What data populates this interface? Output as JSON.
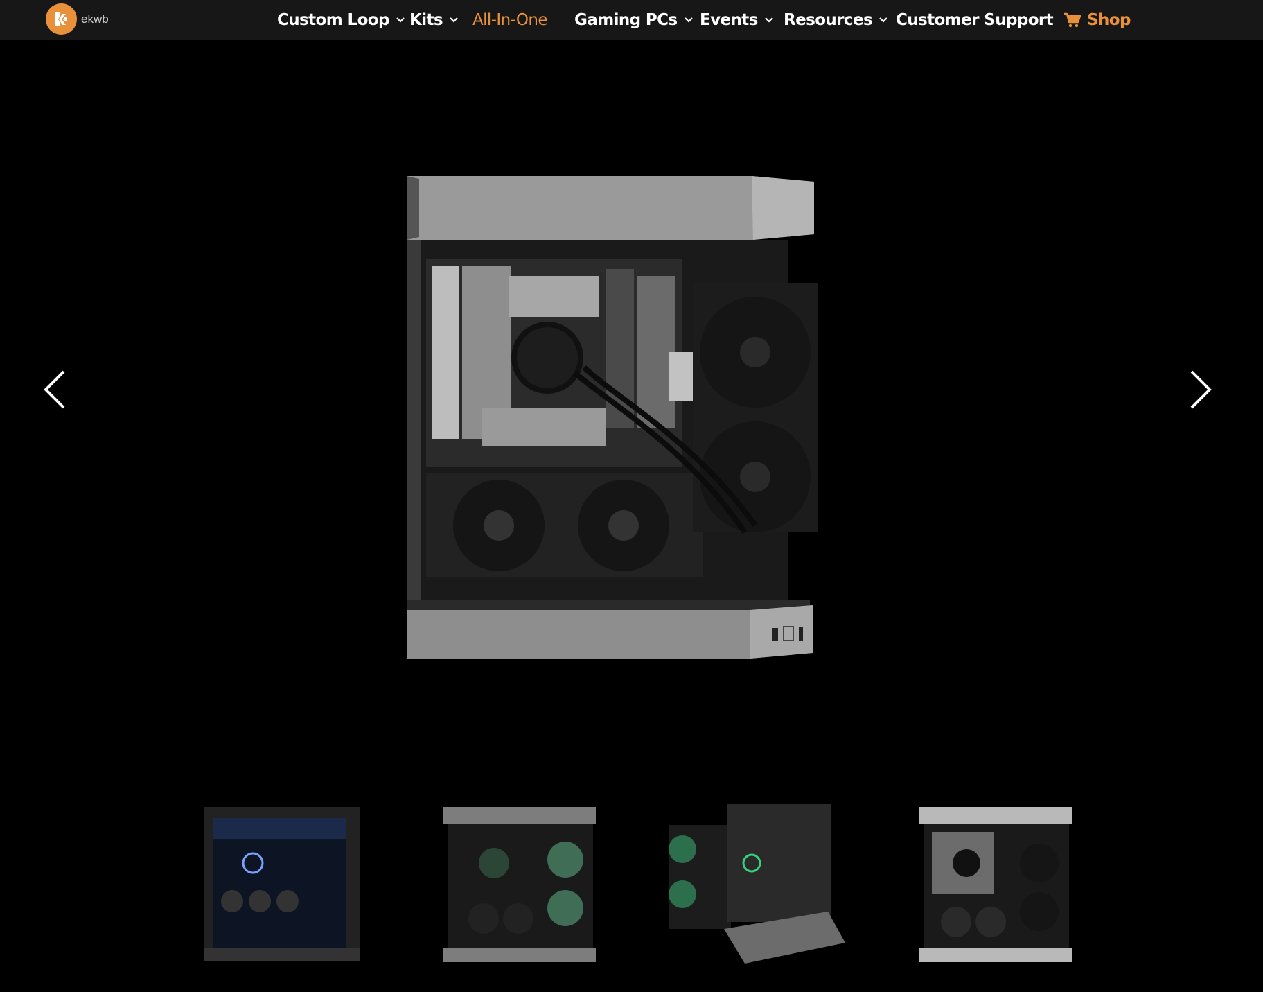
{
  "brand": {
    "name": "ekwb",
    "accent": "#e8913a"
  },
  "nav": {
    "items": [
      {
        "label": "Custom Loop",
        "dropdown": true
      },
      {
        "label": "Kits",
        "dropdown": true
      },
      {
        "label": "All-In-One",
        "dropdown": false,
        "active": true
      },
      {
        "label": "Gaming PCs",
        "dropdown": true
      },
      {
        "label": "Events",
        "dropdown": true
      },
      {
        "label": "Resources",
        "dropdown": true
      },
      {
        "label": "Customer Support",
        "dropdown": false
      }
    ],
    "shop_label": "Shop",
    "shop_icon": "cart-icon"
  },
  "gallery": {
    "prev_icon": "chevron-left-icon",
    "next_icon": "chevron-right-icon",
    "thumbnails": [
      {
        "variant": "black case, blue lighting"
      },
      {
        "variant": "grey case, green fans"
      },
      {
        "variant": "open frame case"
      },
      {
        "variant": "white case"
      }
    ]
  }
}
